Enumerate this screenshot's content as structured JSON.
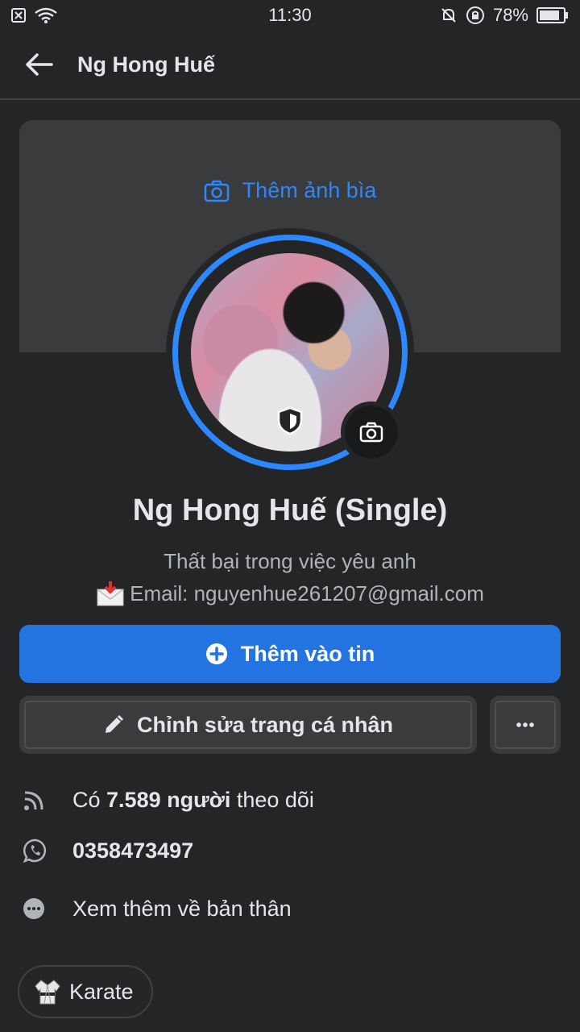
{
  "status_bar": {
    "time": "11:30",
    "battery": "78%"
  },
  "app_bar": {
    "title": "Ng Hong Huế"
  },
  "cover": {
    "add_label": "Thêm ảnh bìa"
  },
  "profile": {
    "name": "Ng Hong Huế (Single)",
    "bio_line": "Thất bại trong việc yêu anh",
    "email_line": "Email: nguyenhue261207@gmail.com"
  },
  "actions": {
    "story_label": "Thêm vào tin",
    "edit_label": "Chỉnh sửa trang cá nhân",
    "more_label": "···"
  },
  "info": {
    "followers_prefix": "Có ",
    "followers_count": "7.589 người",
    "followers_suffix": " theo dõi",
    "phone": "0358473497",
    "see_more": "Xem thêm về bản thân"
  },
  "interests": [
    {
      "label": "Karate"
    }
  ],
  "colors": {
    "background": "#242526",
    "accent": "#2d88ff",
    "primary_button": "#2374e1",
    "secondary_button": "#3a3b3c"
  }
}
